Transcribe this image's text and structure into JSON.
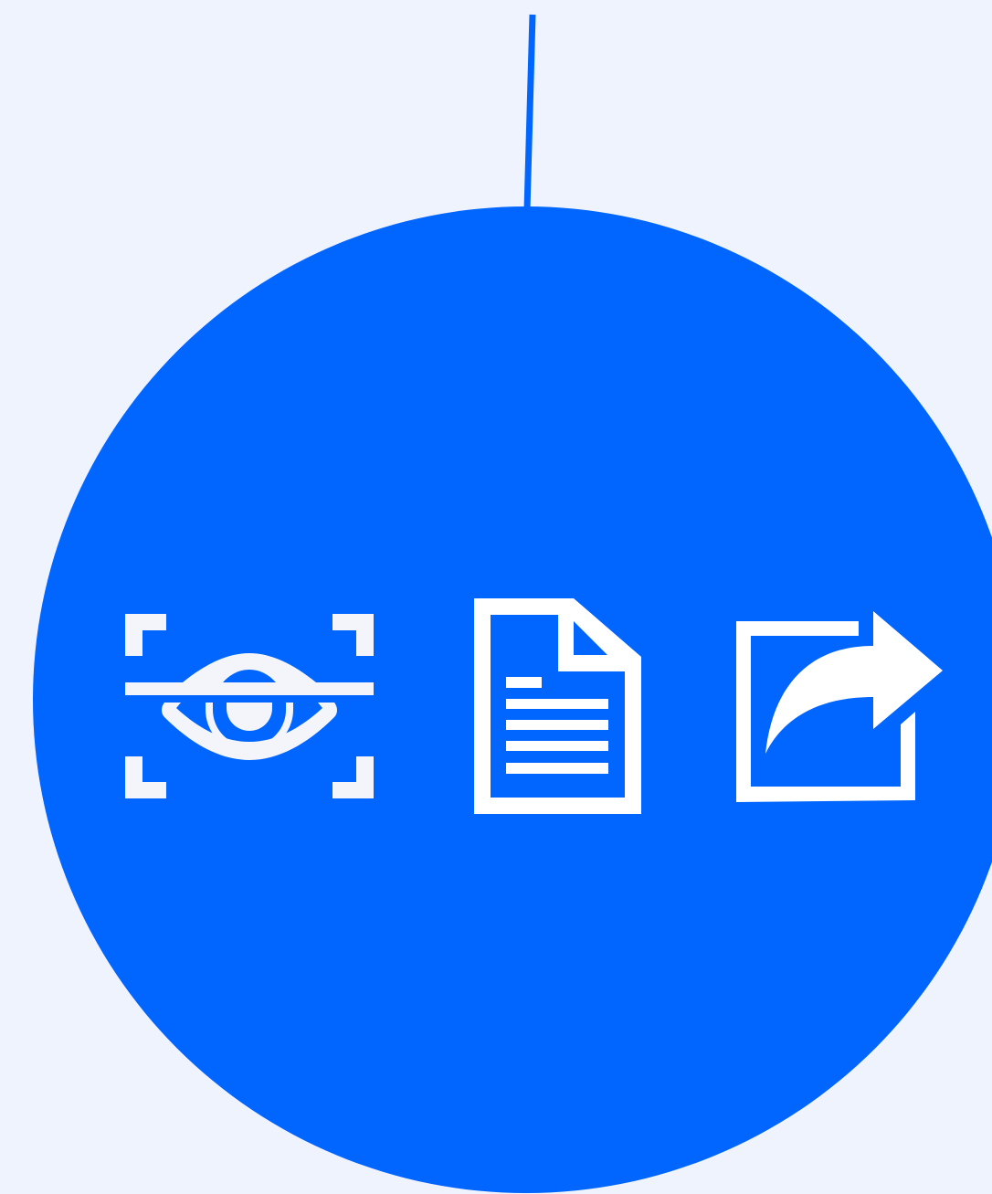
{
  "colors": {
    "background": "#eff3fe",
    "accent": "#0066ff",
    "icon": "#ffffff",
    "icon_soft": "#f3f5fa"
  },
  "icons": {
    "left": "eye-scan-icon",
    "middle": "document-icon",
    "right": "share-export-icon"
  }
}
